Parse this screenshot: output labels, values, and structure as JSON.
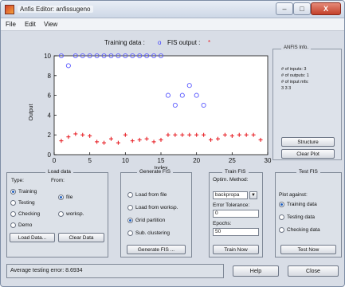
{
  "window": {
    "title": "Anfis Editor: anfissugeno",
    "controls": {
      "minimize": "–",
      "maximize": "□",
      "close": "X"
    }
  },
  "menu": [
    "File",
    "Edit",
    "View"
  ],
  "plot_header": {
    "training_label": "Training data :",
    "training_marker": "o",
    "fis_label": "FIS output :",
    "fis_marker": "*"
  },
  "chart_data": {
    "type": "scatter",
    "xlabel": "Index",
    "ylabel": "Output",
    "xlim": [
      0,
      30
    ],
    "ylim": [
      0,
      10
    ],
    "xticks": [
      0,
      5,
      10,
      15,
      20,
      25,
      30
    ],
    "yticks": [
      0,
      2,
      4,
      6,
      8,
      10
    ],
    "grid": false,
    "series": [
      {
        "name": "Training data",
        "marker": "o",
        "color": "#5a5aff",
        "points": [
          [
            1,
            10
          ],
          [
            2,
            9
          ],
          [
            3,
            10
          ],
          [
            4,
            10
          ],
          [
            5,
            10
          ],
          [
            6,
            10
          ],
          [
            7,
            10
          ],
          [
            8,
            10
          ],
          [
            9,
            10
          ],
          [
            10,
            10
          ],
          [
            11,
            10
          ],
          [
            12,
            10
          ],
          [
            13,
            10
          ],
          [
            14,
            10
          ],
          [
            15,
            10
          ],
          [
            16,
            6
          ],
          [
            17,
            5
          ],
          [
            18,
            6
          ],
          [
            19,
            7
          ],
          [
            20,
            6
          ],
          [
            21,
            5
          ]
        ]
      },
      {
        "name": "FIS output",
        "marker": "*",
        "color": "#e8242a",
        "points": [
          [
            1,
            1.4
          ],
          [
            2,
            1.8
          ],
          [
            3,
            2.1
          ],
          [
            4,
            2.0
          ],
          [
            5,
            1.9
          ],
          [
            6,
            1.3
          ],
          [
            7,
            1.2
          ],
          [
            8,
            1.6
          ],
          [
            9,
            1.2
          ],
          [
            10,
            2.0
          ],
          [
            11,
            1.4
          ],
          [
            12,
            1.5
          ],
          [
            13,
            1.6
          ],
          [
            14,
            1.3
          ],
          [
            15,
            1.5
          ],
          [
            16,
            2.0
          ],
          [
            17,
            2.0
          ],
          [
            18,
            2.0
          ],
          [
            19,
            2.0
          ],
          [
            20,
            2.0
          ],
          [
            21,
            2.0
          ],
          [
            22,
            1.5
          ],
          [
            23,
            1.6
          ],
          [
            24,
            2.0
          ],
          [
            25,
            1.9
          ],
          [
            26,
            2.0
          ],
          [
            27,
            2.0
          ],
          [
            28,
            2.0
          ],
          [
            29,
            1.5
          ]
        ]
      }
    ]
  },
  "anfis_info": {
    "title": "ANFIS Info.",
    "lines": [
      "# of inputs: 3",
      "# of outputs: 1",
      "# of input mfs:",
      "3 3 3"
    ],
    "structure_button": "Structure",
    "clear_plot_button": "Clear Plot"
  },
  "load_data": {
    "title": "Load data",
    "type_label": "Type:",
    "from_label": "From:",
    "types": [
      {
        "label": "Training",
        "selected": true
      },
      {
        "label": "Testing",
        "selected": false
      },
      {
        "label": "Checking",
        "selected": false
      },
      {
        "label": "Demo",
        "selected": false
      }
    ],
    "from": [
      {
        "label": "file",
        "selected": true
      },
      {
        "label": "worksp.",
        "selected": false
      }
    ],
    "load_button": "Load Data...",
    "clear_button": "Clear Data"
  },
  "generate_fis": {
    "title": "Generate FIS",
    "options": [
      {
        "label": "Load from file",
        "selected": false
      },
      {
        "label": "Load from worksp.",
        "selected": false
      },
      {
        "label": "Grid partition",
        "selected": true
      },
      {
        "label": "Sub. clustering",
        "selected": false
      }
    ],
    "button": "Generate FIS ..."
  },
  "train_fis": {
    "title": "Train FIS",
    "optim_label": "Optim. Method:",
    "optim_value": "backpropa",
    "error_label": "Error Tolerance:",
    "error_value": "0",
    "epochs_label": "Epochs:",
    "epochs_value": "50",
    "button": "Train Now"
  },
  "test_fis": {
    "title": "Test FIS",
    "plot_against": "Plot against:",
    "options": [
      {
        "label": "Training data",
        "selected": true
      },
      {
        "label": "Testing data",
        "selected": false
      },
      {
        "label": "Checking data",
        "selected": false
      }
    ],
    "button": "Test Now"
  },
  "status": {
    "message": "Average testing error: 8.6934",
    "help_button": "Help",
    "close_button": "Close"
  }
}
